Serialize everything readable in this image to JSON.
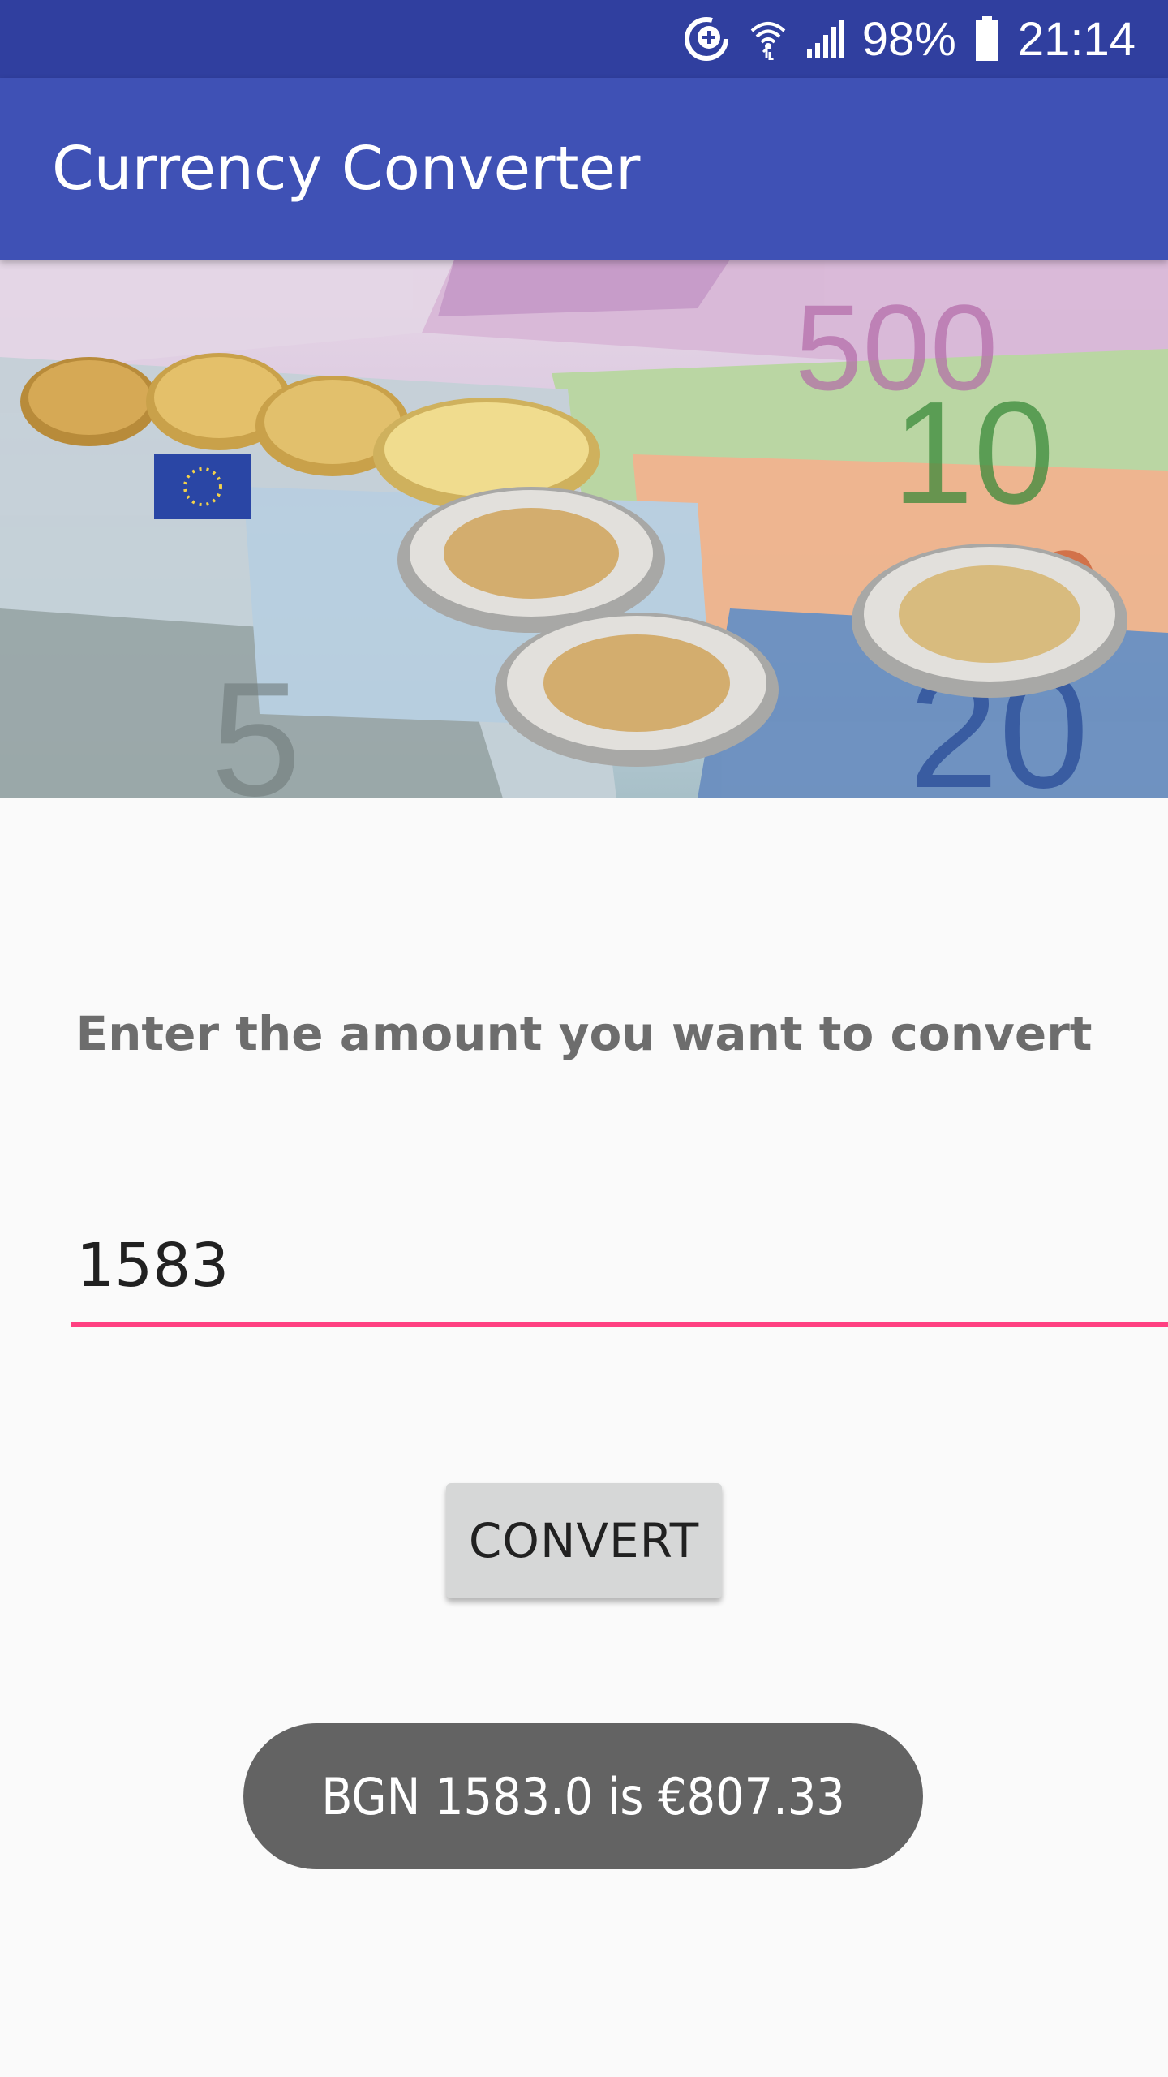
{
  "status_bar": {
    "battery": "98%",
    "time": "21:14",
    "icons": [
      "sync-icon",
      "wifi-icon",
      "signal-icon",
      "battery-icon"
    ]
  },
  "app_bar": {
    "title": "Currency Converter",
    "color": "#3f51b5",
    "status_color": "#303f9f"
  },
  "banner": {
    "image": "euro-banknotes-and-coins"
  },
  "main": {
    "prompt": "Enter the amount you want to convert",
    "amount_value": "1583",
    "convert_label": "CONVERT",
    "accent_color": "#ff4081"
  },
  "toast": {
    "message": "BGN 1583.0 is €807.33"
  }
}
